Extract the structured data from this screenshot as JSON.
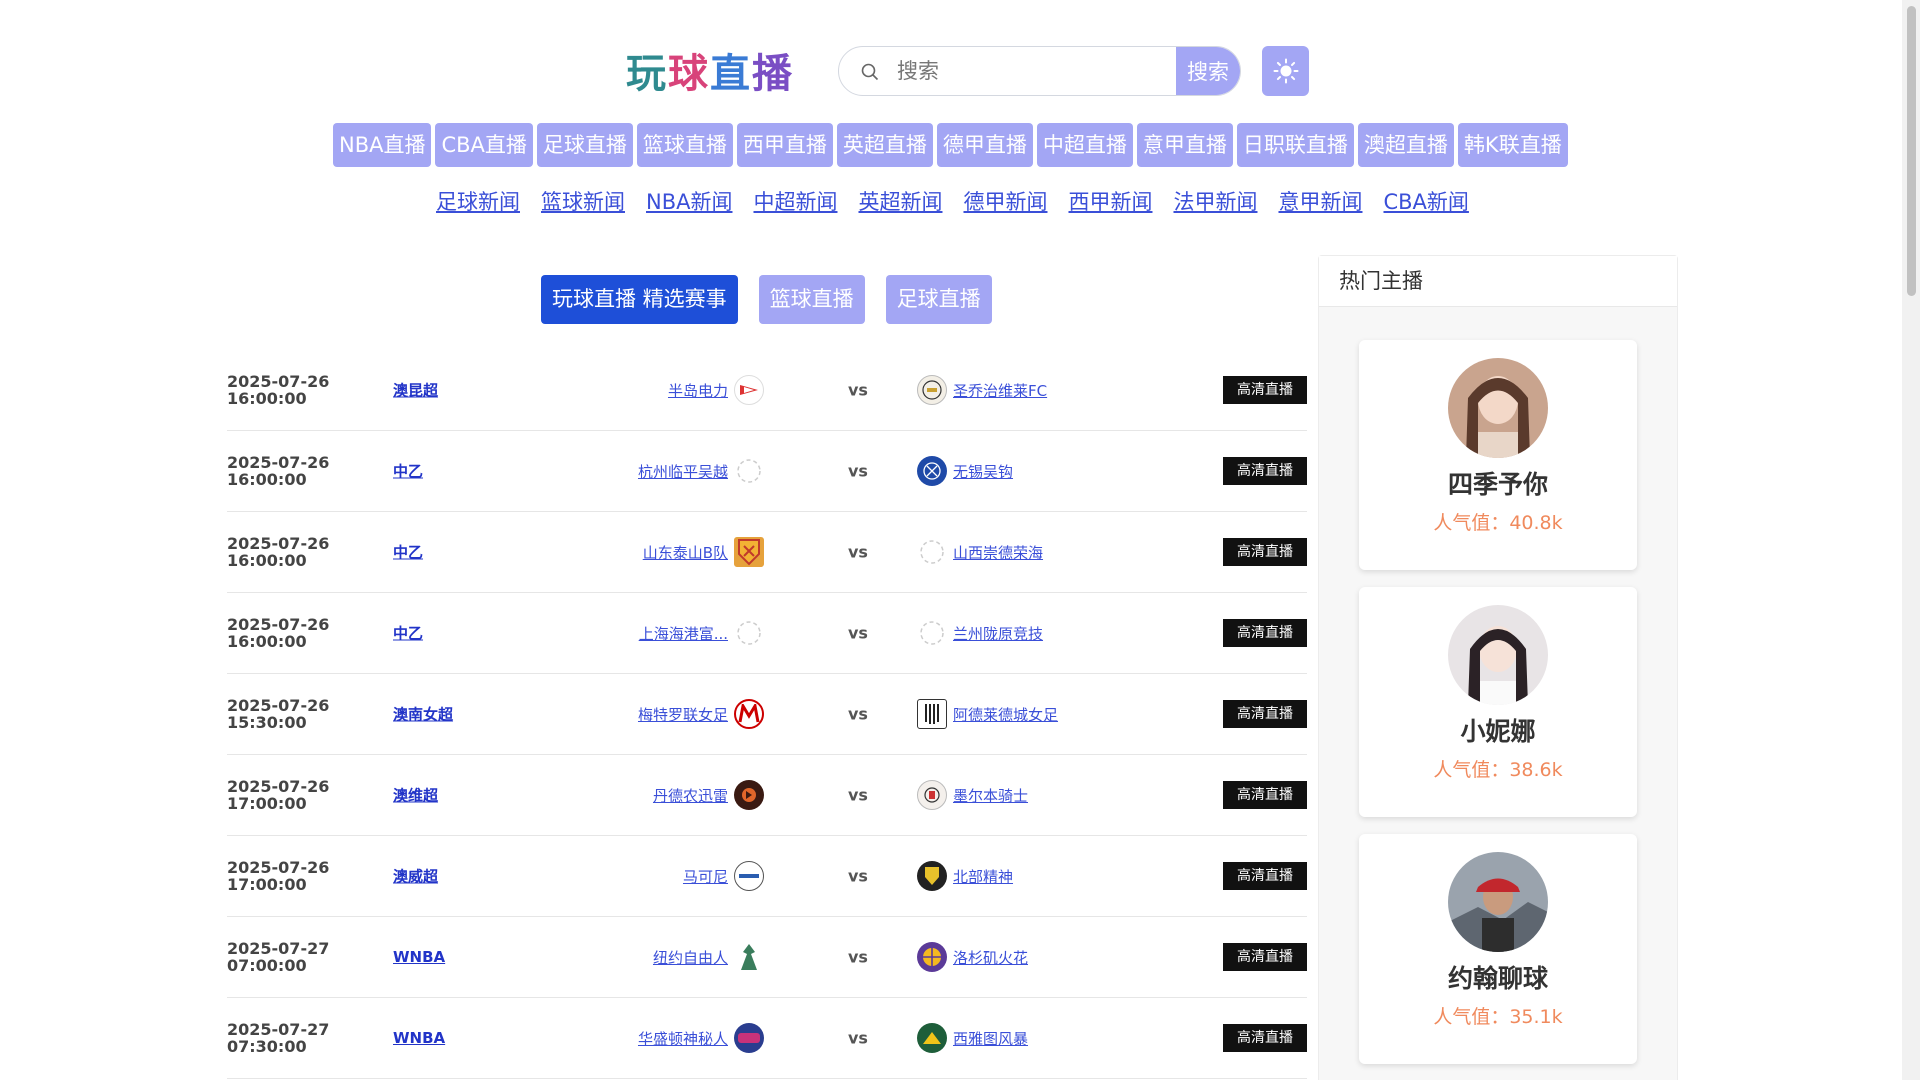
{
  "logo": {
    "c1": "玩",
    "c2": "球",
    "c3": "直",
    "c4": "播"
  },
  "search": {
    "placeholder": "搜索",
    "button": "搜索"
  },
  "live_nav": [
    "NBA直播",
    "CBA直播",
    "足球直播",
    "篮球直播",
    "西甲直播",
    "英超直播",
    "德甲直播",
    "中超直播",
    "意甲直播",
    "日职联直播",
    "澳超直播",
    "韩K联直播"
  ],
  "news_nav": [
    "足球新闻",
    "篮球新闻",
    "NBA新闻",
    "中超新闻",
    "英超新闻",
    "德甲新闻",
    "西甲新闻",
    "法甲新闻",
    "意甲新闻",
    "CBA新闻"
  ],
  "tabs": [
    "玩球直播 精选赛事",
    "篮球直播",
    "足球直播"
  ],
  "matches": [
    {
      "date": "2025-07-26",
      "time": "16:00:00",
      "league": "澳昆超",
      "home": "半岛电力",
      "away": "圣乔治维莱FC",
      "vs": "vs",
      "live": "高清直播"
    },
    {
      "date": "2025-07-26",
      "time": "16:00:00",
      "league": "中乙",
      "home": "杭州临平吴越",
      "away": "无锡吴钩",
      "vs": "vs",
      "live": "高清直播"
    },
    {
      "date": "2025-07-26",
      "time": "16:00:00",
      "league": "中乙",
      "home": "山东泰山B队",
      "away": "山西崇德荣海",
      "vs": "vs",
      "live": "高清直播"
    },
    {
      "date": "2025-07-26",
      "time": "16:00:00",
      "league": "中乙",
      "home": "上海海港富...",
      "away": "兰州陇原竞技",
      "vs": "vs",
      "live": "高清直播"
    },
    {
      "date": "2025-07-26",
      "time": "15:30:00",
      "league": "澳南女超",
      "home": "梅特罗联女足",
      "away": "阿德莱德城女足",
      "vs": "vs",
      "live": "高清直播"
    },
    {
      "date": "2025-07-26",
      "time": "17:00:00",
      "league": "澳维超",
      "home": "丹德农迅雷",
      "away": "墨尔本骑士",
      "vs": "vs",
      "live": "高清直播"
    },
    {
      "date": "2025-07-26",
      "time": "17:00:00",
      "league": "澳威超",
      "home": "马可尼",
      "away": "北部精神",
      "vs": "vs",
      "live": "高清直播"
    },
    {
      "date": "2025-07-27",
      "time": "07:00:00",
      "league": "WNBA",
      "home": "纽约自由人",
      "away": "洛杉矶火花",
      "vs": "vs",
      "live": "高清直播"
    },
    {
      "date": "2025-07-27",
      "time": "07:30:00",
      "league": "WNBA",
      "home": "华盛顿神秘人",
      "away": "西雅图风暴",
      "vs": "vs",
      "live": "高清直播"
    }
  ],
  "sidebar": {
    "title": "热门主播",
    "anchors": [
      {
        "name": "四季予你",
        "popularity": "人气值：40.8k"
      },
      {
        "name": "小妮娜",
        "popularity": "人气值：38.6k"
      },
      {
        "name": "约翰聊球",
        "popularity": "人气值：35.1k"
      }
    ]
  },
  "colors": {
    "nav_bg": "#a3a6f4",
    "tab_active": "#1e4fd8",
    "link": "#3a4fd8",
    "popularity": "#f08a5d"
  }
}
